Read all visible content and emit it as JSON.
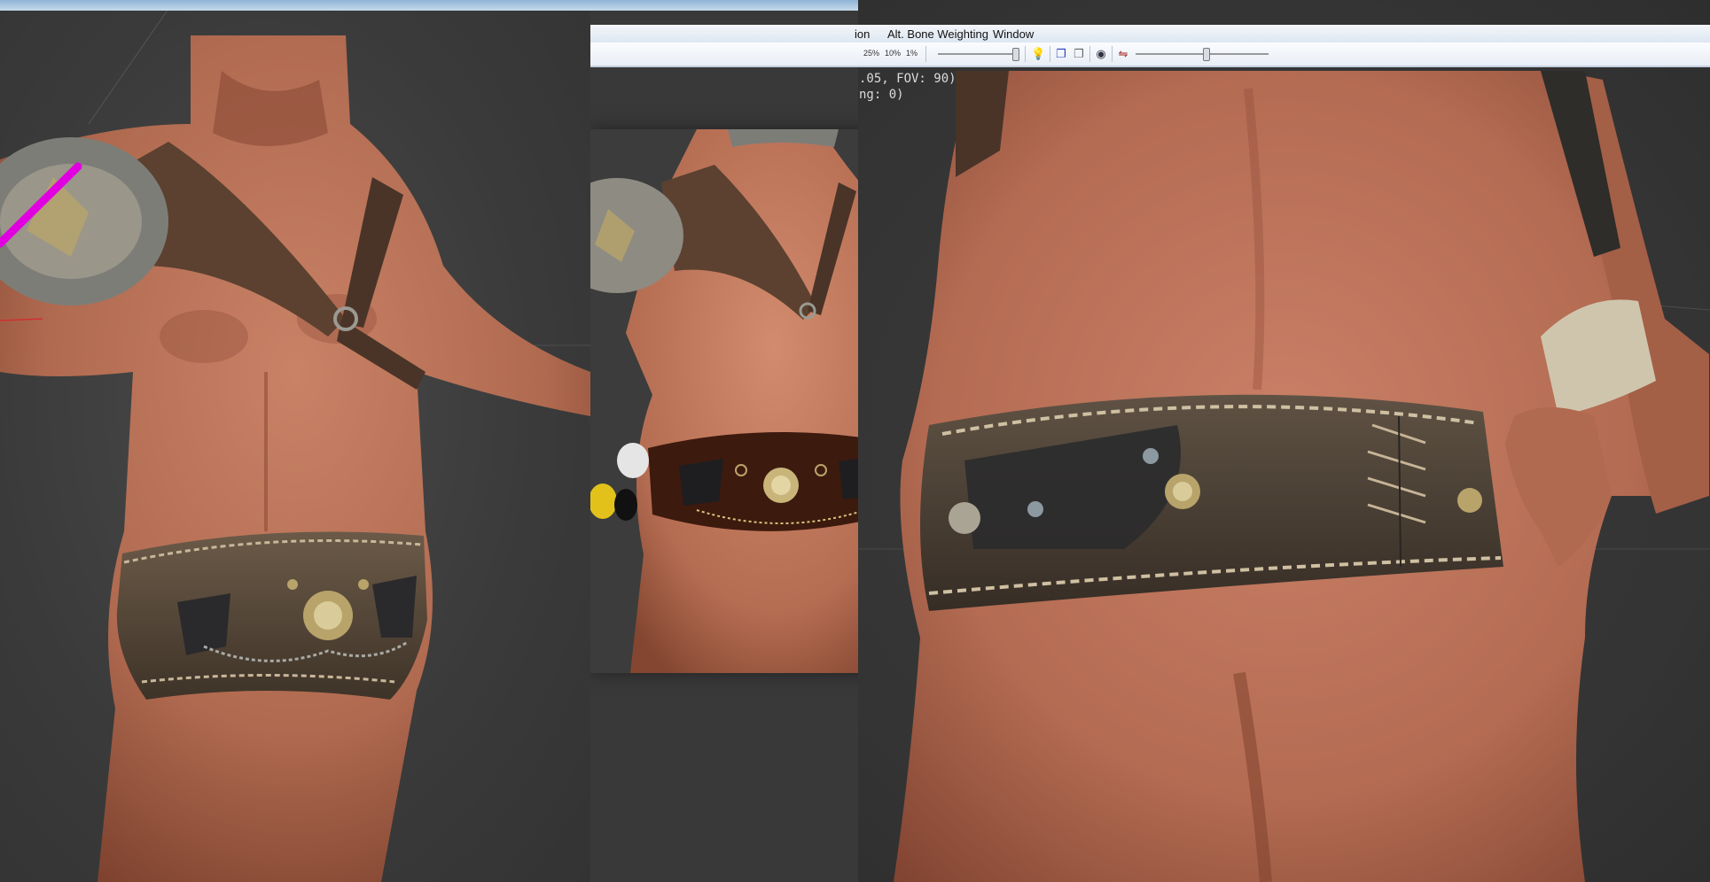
{
  "menubar": {
    "items": [
      "ion",
      "Alt. Bone Weighting",
      "Window"
    ]
  },
  "toolbar": {
    "zoom_labels": [
      "25%",
      "10%",
      "1%"
    ]
  },
  "viewport": {
    "camera_info": ".05, FOV: 90)",
    "camera_info_2": "ng: 0)"
  },
  "colors": {
    "skin": "#b86f54",
    "skin_shadow": "#7a3f2c",
    "leather": "#5a4a3a",
    "leather_dark": "#2f2a25",
    "strap": "#4a3428",
    "metal": "#8a8a82",
    "brass": "#b8a46a",
    "bone_highlight": "#e000e0",
    "viewport_bg": "#3a3a3a"
  }
}
